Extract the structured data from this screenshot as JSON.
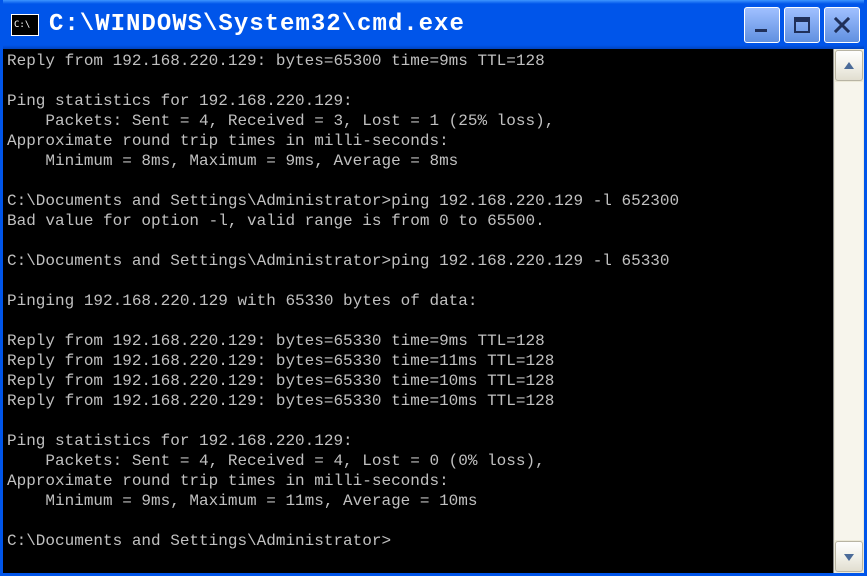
{
  "titlebar": {
    "icon_label": "C:\\",
    "title": "C:\\WINDOWS\\System32\\cmd.exe"
  },
  "controls": {
    "minimize": "minimize-button",
    "maximize": "maximize-button",
    "close": "close-button"
  },
  "terminal": {
    "lines": [
      "Reply from 192.168.220.129: bytes=65300 time=9ms TTL=128",
      "",
      "Ping statistics for 192.168.220.129:",
      "    Packets: Sent = 4, Received = 3, Lost = 1 (25% loss),",
      "Approximate round trip times in milli-seconds:",
      "    Minimum = 8ms, Maximum = 9ms, Average = 8ms",
      "",
      "C:\\Documents and Settings\\Administrator>ping 192.168.220.129 -l 652300",
      "Bad value for option -l, valid range is from 0 to 65500.",
      "",
      "C:\\Documents and Settings\\Administrator>ping 192.168.220.129 -l 65330",
      "",
      "Pinging 192.168.220.129 with 65330 bytes of data:",
      "",
      "Reply from 192.168.220.129: bytes=65330 time=9ms TTL=128",
      "Reply from 192.168.220.129: bytes=65330 time=11ms TTL=128",
      "Reply from 192.168.220.129: bytes=65330 time=10ms TTL=128",
      "Reply from 192.168.220.129: bytes=65330 time=10ms TTL=128",
      "",
      "Ping statistics for 192.168.220.129:",
      "    Packets: Sent = 4, Received = 4, Lost = 0 (0% loss),",
      "Approximate round trip times in milli-seconds:",
      "    Minimum = 9ms, Maximum = 11ms, Average = 10ms",
      "",
      "C:\\Documents and Settings\\Administrator>"
    ]
  },
  "colors": {
    "titlebar": "#0055ea",
    "terminal_bg": "#000000",
    "terminal_fg": "#c0c0c0",
    "scrollbar_bg": "#ece9d8"
  }
}
